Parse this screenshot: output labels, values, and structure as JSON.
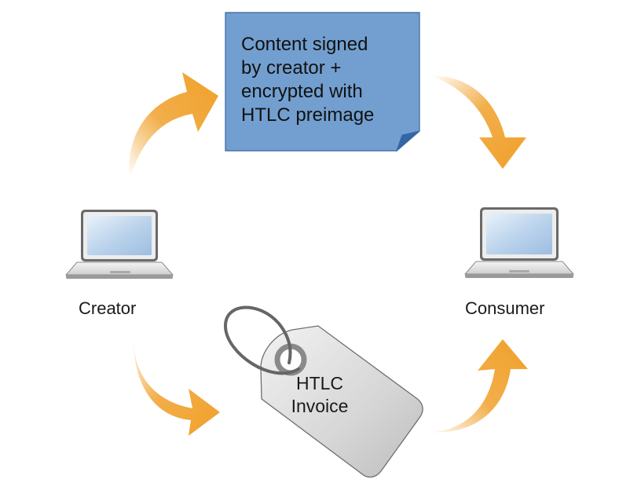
{
  "diagram": {
    "creator_label": "Creator",
    "consumer_label": "Consumer",
    "note_lines": [
      "Content signed",
      "by creator +",
      "encrypted with",
      "HTLC preimage"
    ],
    "tag_lines": [
      "HTLC",
      "Invoice"
    ]
  },
  "colors": {
    "arrow": "#f0a02a",
    "note_fill": "#729fcf",
    "note_border": "#3465a4",
    "tag_fill": "#d3d3d3",
    "tag_border": "#6e6e6e",
    "screen": "#bcd4ec"
  },
  "icons": [
    "laptop-icon",
    "laptop-icon",
    "price-tag-icon",
    "curved-arrow-icon"
  ]
}
